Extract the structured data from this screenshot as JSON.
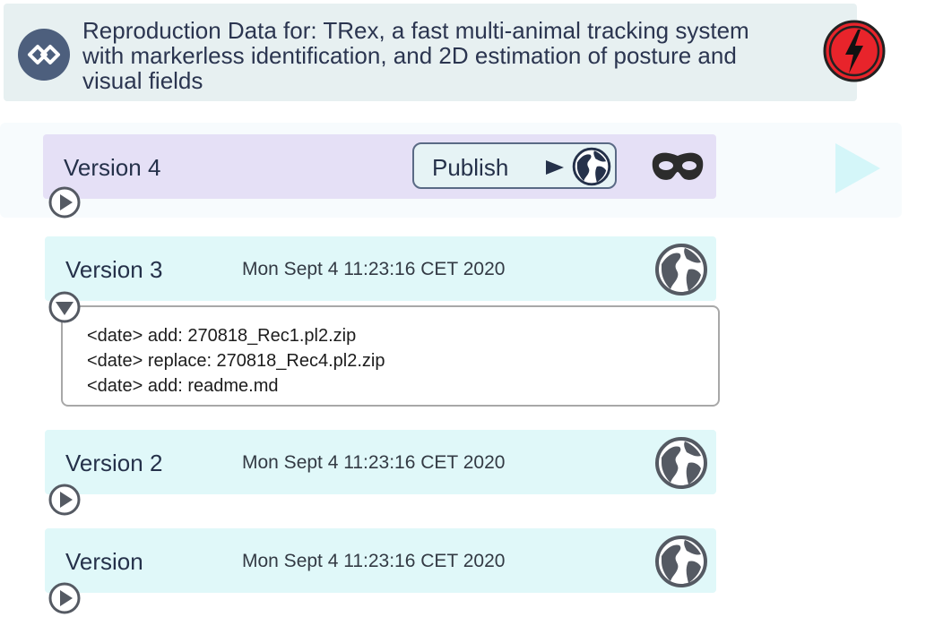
{
  "header": {
    "title": "Reproduction Data for: TRex, a fast multi-animal tracking system with markerless identification, and 2D estimation of posture and visual fields",
    "logo_icon": "dataset-logo-icon",
    "alert_icon": "lightning-alert-icon"
  },
  "colors": {
    "header_bg": "#e7f0f1",
    "current_version_bg": "#e5e0f6",
    "version_bg": "#e0f8f9",
    "icon_dark": "#555a63",
    "alert_red": "#e8242b",
    "next_arrow": "#d4f6f9"
  },
  "current_version": {
    "name": "Version 4",
    "publish_label": "Publish",
    "publish_arrow_icon": "play-right-icon",
    "publish_globe_icon": "globe-icon",
    "private_icon": "mask-icon",
    "toggle_icon": "play-right-circle-icon",
    "expanded": false
  },
  "next_icon": "next-arrow-icon",
  "versions": [
    {
      "name": "Version 3",
      "date": "Mon Sept 4 11:23:16 CET 2020",
      "status_icon": "globe-icon",
      "toggle_icon": "chevron-down-circle-icon",
      "expanded": true,
      "changes": [
        "<date> add: 270818_Rec1.pl2.zip",
        "<date> replace: 270818_Rec4.pl2.zip",
        "<date> add: readme.md"
      ]
    },
    {
      "name": "Version 2",
      "date": "Mon Sept 4 11:23:16 CET 2020",
      "status_icon": "globe-icon",
      "toggle_icon": "play-right-circle-icon",
      "expanded": false
    },
    {
      "name": "Version",
      "date": "Mon Sept 4 11:23:16 CET 2020",
      "status_icon": "globe-icon",
      "toggle_icon": "play-right-circle-icon",
      "expanded": false
    }
  ]
}
